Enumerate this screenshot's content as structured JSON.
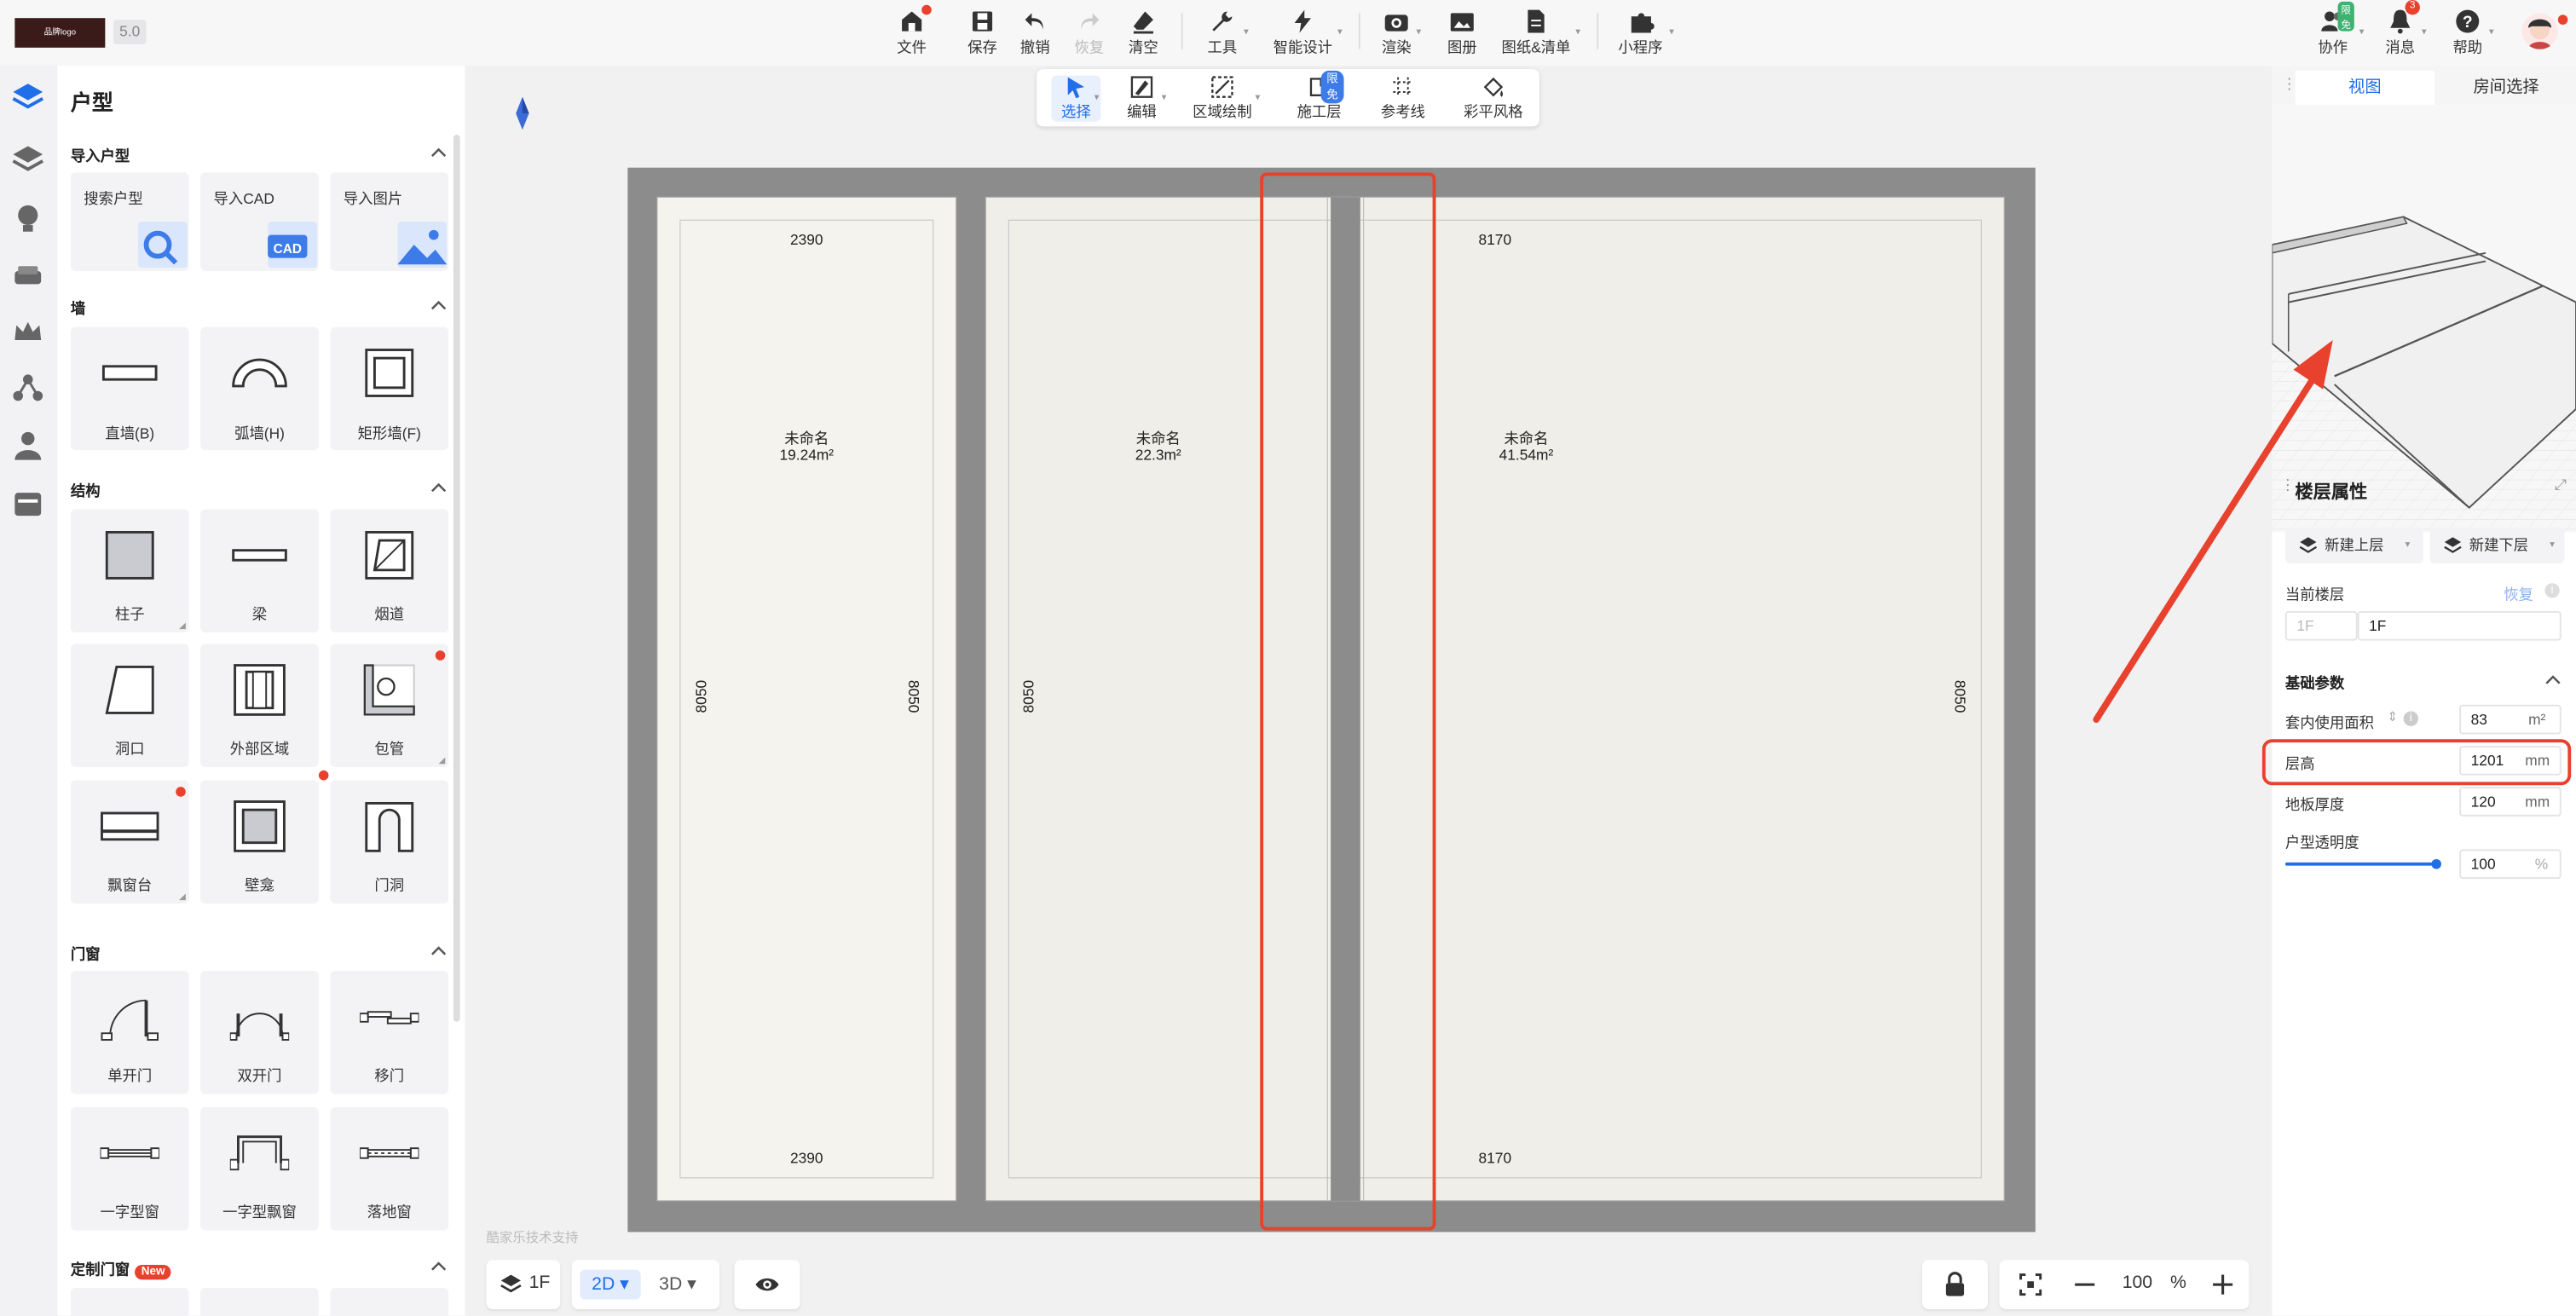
{
  "app": {
    "logo_text": "品牌logo",
    "version": "5.0"
  },
  "toolbar": {
    "file": "文件",
    "save": "保存",
    "undo": "撤销",
    "redo": "恢复",
    "clear": "清空",
    "tools": "工具",
    "smart_design": "智能设计",
    "render": "渲染",
    "album": "图册",
    "drawings": "图纸&清单",
    "mini_program": "小程序",
    "collab": "协作",
    "collab_badge": "限免",
    "messages": "消息",
    "messages_badge": "3",
    "help": "帮助"
  },
  "subtoolbar": {
    "select": "选择",
    "edit": "编辑",
    "region_draw": "区域绘制",
    "construction_layer": "施工层",
    "construction_badge": "限免",
    "reference_line": "参考线",
    "color_style": "彩平风格"
  },
  "left_panel": {
    "title": "户型",
    "sections": {
      "import": {
        "title": "导入户型",
        "items": [
          "搜索户型",
          "导入CAD",
          "导入图片"
        ]
      },
      "wall": {
        "title": "墙",
        "items": [
          "直墙(B)",
          "弧墙(H)",
          "矩形墙(F)"
        ]
      },
      "structure": {
        "title": "结构",
        "items": [
          "柱子",
          "梁",
          "烟道",
          "洞口",
          "外部区域",
          "包管",
          "飘窗台",
          "壁龛",
          "门洞"
        ]
      },
      "doors_windows": {
        "title": "门窗",
        "items": [
          "单开门",
          "双开门",
          "移门",
          "一字型窗",
          "一字型飘窗",
          "落地窗"
        ]
      },
      "custom": {
        "title": "定制门窗",
        "badge": "New"
      }
    }
  },
  "floorplan": {
    "rooms": [
      {
        "name": "未命名",
        "area": "19.24m²"
      },
      {
        "name": "未命名",
        "area": "22.3m²"
      },
      {
        "name": "未命名",
        "area": "41.54m²"
      }
    ],
    "dims": {
      "top_left": "2390",
      "top_right": "8170",
      "bottom_left": "2390",
      "bottom_right": "8170",
      "side_a": "8050",
      "side_b": "8050",
      "side_c": "8050",
      "side_d": "8050"
    },
    "watermark": "酷家乐技术支持"
  },
  "bottom": {
    "floor": "1F",
    "mode_2d": "2D",
    "mode_3d": "3D",
    "zoom": "100",
    "zoom_unit": "%"
  },
  "right_panel": {
    "tabs": [
      "视图",
      "房间选择"
    ],
    "floor_props_title": "楼层属性",
    "new_upper": "新建上层",
    "new_lower": "新建下层",
    "current_floor_label": "当前楼层",
    "restore": "恢复",
    "current_floor_prefix": "1F",
    "current_floor_value": "1F",
    "basic_params_title": "基础参数",
    "usable_area_label": "套内使用面积",
    "usable_area_value": "83",
    "usable_area_unit": "m²",
    "floor_height_label": "层高",
    "floor_height_value": "1201",
    "floor_height_unit": "mm",
    "slab_thickness_label": "地板厚度",
    "slab_thickness_value": "120",
    "slab_thickness_unit": "mm",
    "transparency_label": "户型透明度",
    "transparency_value": "100",
    "transparency_unit": "%",
    "transparency_level": 1.0
  },
  "colors": {
    "accent": "#1f6fe8",
    "annotation_red": "#e8412d",
    "wall": "#8c8c8c",
    "floor": "#efede8"
  }
}
